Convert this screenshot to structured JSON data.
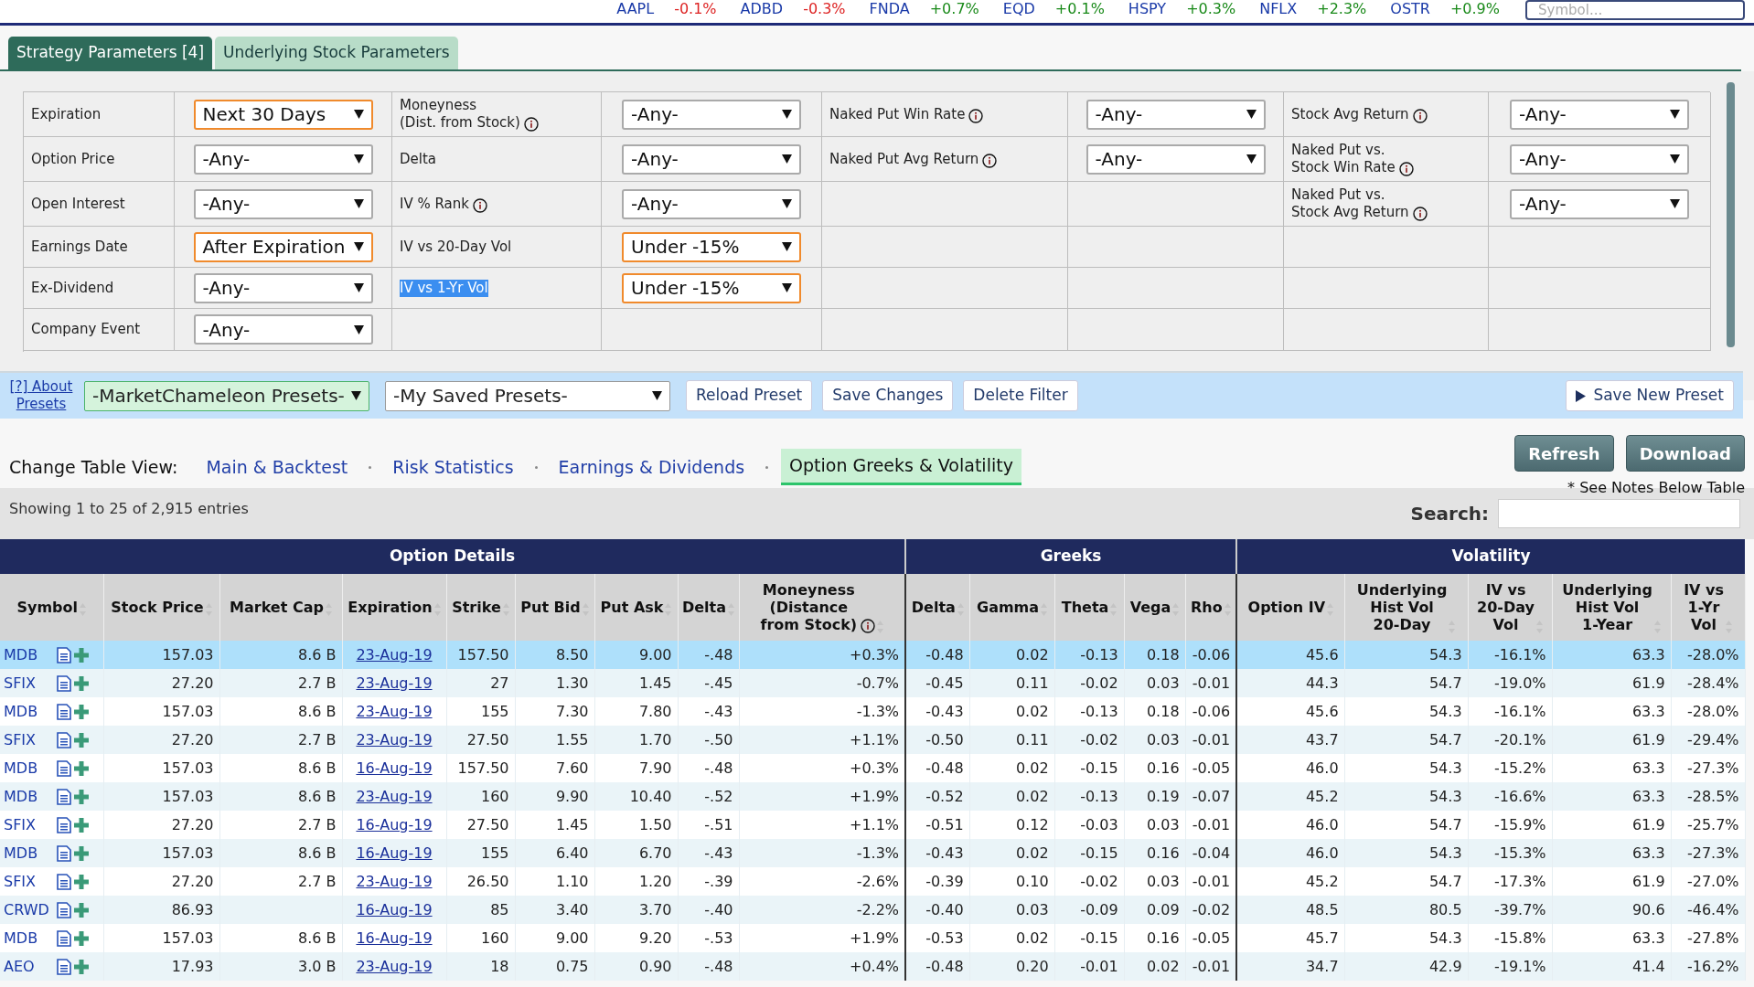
{
  "ticker": [
    {
      "symbol": "AAPL",
      "change": "-0.1%",
      "color": "#dd2222"
    },
    {
      "symbol": "ADBD",
      "change": "-0.3%",
      "color": "#dd2222"
    },
    {
      "symbol": "FNDA",
      "change": "+0.7%",
      "color": "#1a8a1a"
    },
    {
      "symbol": "EQD",
      "change": "+0.1%",
      "color": "#1a8a1a"
    },
    {
      "symbol": "HSPY",
      "change": "+0.3%",
      "color": "#1a8a1a"
    },
    {
      "symbol": "NFLX",
      "change": "+2.3%",
      "color": "#1a8a1a"
    },
    {
      "symbol": "OSTR",
      "change": "+0.9%",
      "color": "#1a8a1a"
    }
  ],
  "symbol_search": {
    "placeholder": "Symbol..."
  },
  "tabs": [
    {
      "label": "Strategy Parameters [4]",
      "selected": true
    },
    {
      "label": "Underlying Stock Parameters",
      "selected": false
    }
  ],
  "filters": {
    "rows": [
      {
        "cells": [
          {
            "label": [
              "Expiration"
            ],
            "info": false,
            "value": "Next 30 Days",
            "active": true
          },
          {
            "label": [
              "Moneyness",
              "(Dist. from Stock)"
            ],
            "info": true,
            "value": "-Any-",
            "active": false
          },
          {
            "label": [
              "Naked Put Win Rate"
            ],
            "info": true,
            "value": "-Any-",
            "active": false
          },
          {
            "label": [
              "Stock Avg Return"
            ],
            "info": true,
            "value": "-Any-",
            "active": false
          }
        ]
      },
      {
        "cells": [
          {
            "label": [
              "Option Price"
            ],
            "info": false,
            "value": "-Any-",
            "active": false
          },
          {
            "label": [
              "Delta"
            ],
            "info": false,
            "value": "-Any-",
            "active": false
          },
          {
            "label": [
              "Naked Put Avg Return"
            ],
            "info": true,
            "value": "-Any-",
            "active": false
          },
          {
            "label": [
              "Naked Put vs.",
              "Stock Win Rate"
            ],
            "info": true,
            "value": "-Any-",
            "active": false
          }
        ]
      },
      {
        "cells": [
          {
            "label": [
              "Open Interest"
            ],
            "info": false,
            "value": "-Any-",
            "active": false
          },
          {
            "label": [
              "IV % Rank"
            ],
            "info": true,
            "value": "-Any-",
            "active": false
          },
          null,
          {
            "label": [
              "Naked Put vs.",
              "Stock Avg Return"
            ],
            "info": true,
            "value": "-Any-",
            "active": false
          }
        ]
      },
      {
        "cells": [
          {
            "label": [
              "Earnings Date"
            ],
            "info": false,
            "value": "After Expiration",
            "active": true
          },
          {
            "label": [
              "IV vs 20-Day Vol"
            ],
            "info": false,
            "value": "Under -15%",
            "active": true
          },
          null,
          null
        ]
      },
      {
        "cells": [
          {
            "label": [
              "Ex-Dividend"
            ],
            "info": false,
            "value": "-Any-",
            "active": false
          },
          {
            "label": [
              "IV vs 1-Yr Vol"
            ],
            "info": false,
            "text_selected": true,
            "value": "Under -15%",
            "active": true
          },
          null,
          null
        ]
      },
      {
        "cells": [
          {
            "label": [
              "Company Event"
            ],
            "info": false,
            "value": "-Any-",
            "active": false
          },
          null,
          null,
          null
        ]
      }
    ]
  },
  "presets": {
    "about_link": "[?] About Presets",
    "marketchameleon_select": "-MarketChameleon Presets-",
    "saved_select": "-My Saved Presets-",
    "buttons": [
      "Reload Preset",
      "Save Changes",
      "Delete Filter"
    ],
    "save_new": "Save New Preset"
  },
  "table_view": {
    "label": "Change Table View:",
    "views": [
      {
        "label": "Main & Backtest",
        "selected": false
      },
      {
        "label": "Risk Statistics",
        "selected": false
      },
      {
        "label": "Earnings & Dividends",
        "selected": false
      },
      {
        "label": "Option Greeks & Volatility",
        "selected": true
      }
    ]
  },
  "actions": [
    "Refresh",
    "Download"
  ],
  "note": "* See Notes Below Table",
  "showing": "Showing 1 to 25 of 2,915 entries",
  "search": {
    "label": "Search:"
  },
  "table": {
    "groups": [
      {
        "label": "Option Details",
        "columns": [
          {
            "label": [
              "Symbol"
            ]
          },
          {
            "label": [
              "Stock Price"
            ]
          },
          {
            "label": [
              "Market Cap"
            ]
          },
          {
            "label": [
              "Expiration"
            ]
          },
          {
            "label": [
              "Strike"
            ]
          },
          {
            "label": [
              "Put Bid"
            ]
          },
          {
            "label": [
              "Put Ask"
            ]
          },
          {
            "label": [
              "Delta"
            ]
          },
          {
            "label": [
              "Moneyness",
              "(Distance",
              "from Stock)"
            ],
            "info": true
          }
        ]
      },
      {
        "label": "Greeks",
        "columns": [
          {
            "label": [
              "Delta"
            ]
          },
          {
            "label": [
              "Gamma"
            ]
          },
          {
            "label": [
              "Theta"
            ]
          },
          {
            "label": [
              "Vega"
            ]
          },
          {
            "label": [
              "Rho"
            ]
          }
        ]
      },
      {
        "label": "Volatility",
        "columns": [
          {
            "label": [
              "Option IV"
            ]
          },
          {
            "label": [
              "Underlying",
              "Hist Vol",
              "20-Day"
            ]
          },
          {
            "label": [
              "IV vs",
              "20-Day",
              "Vol"
            ]
          },
          {
            "label": [
              "Underlying",
              "Hist Vol",
              "1-Year"
            ]
          },
          {
            "label": [
              "IV vs",
              "1-Yr",
              "Vol"
            ]
          }
        ]
      }
    ],
    "rows": [
      {
        "selected": true,
        "cells": [
          "MDB",
          "157.03",
          "8.6 B",
          "23-Aug-19",
          "157.50",
          "8.50",
          "9.00",
          "-.48",
          "+0.3%",
          "-0.48",
          "0.02",
          "-0.13",
          "0.18",
          "-0.06",
          "45.6",
          "54.3",
          "-16.1%",
          "63.3",
          "-28.0%"
        ]
      },
      {
        "selected": false,
        "cells": [
          "SFIX",
          "27.20",
          "2.7 B",
          "23-Aug-19",
          "27",
          "1.30",
          "1.45",
          "-.45",
          "-0.7%",
          "-0.45",
          "0.11",
          "-0.02",
          "0.03",
          "-0.01",
          "44.3",
          "54.7",
          "-19.0%",
          "61.9",
          "-28.4%"
        ]
      },
      {
        "selected": false,
        "cells": [
          "MDB",
          "157.03",
          "8.6 B",
          "23-Aug-19",
          "155",
          "7.30",
          "7.80",
          "-.43",
          "-1.3%",
          "-0.43",
          "0.02",
          "-0.13",
          "0.18",
          "-0.06",
          "45.6",
          "54.3",
          "-16.1%",
          "63.3",
          "-28.0%"
        ]
      },
      {
        "selected": false,
        "cells": [
          "SFIX",
          "27.20",
          "2.7 B",
          "23-Aug-19",
          "27.50",
          "1.55",
          "1.70",
          "-.50",
          "+1.1%",
          "-0.50",
          "0.11",
          "-0.02",
          "0.03",
          "-0.01",
          "43.7",
          "54.7",
          "-20.1%",
          "61.9",
          "-29.4%"
        ]
      },
      {
        "selected": false,
        "cells": [
          "MDB",
          "157.03",
          "8.6 B",
          "16-Aug-19",
          "157.50",
          "7.60",
          "7.90",
          "-.48",
          "+0.3%",
          "-0.48",
          "0.02",
          "-0.15",
          "0.16",
          "-0.05",
          "46.0",
          "54.3",
          "-15.2%",
          "63.3",
          "-27.3%"
        ]
      },
      {
        "selected": false,
        "cells": [
          "MDB",
          "157.03",
          "8.6 B",
          "23-Aug-19",
          "160",
          "9.90",
          "10.40",
          "-.52",
          "+1.9%",
          "-0.52",
          "0.02",
          "-0.13",
          "0.19",
          "-0.07",
          "45.2",
          "54.3",
          "-16.6%",
          "63.3",
          "-28.5%"
        ]
      },
      {
        "selected": false,
        "cells": [
          "SFIX",
          "27.20",
          "2.7 B",
          "16-Aug-19",
          "27.50",
          "1.45",
          "1.50",
          "-.51",
          "+1.1%",
          "-0.51",
          "0.12",
          "-0.03",
          "0.03",
          "-0.01",
          "46.0",
          "54.7",
          "-15.9%",
          "61.9",
          "-25.7%"
        ]
      },
      {
        "selected": false,
        "cells": [
          "MDB",
          "157.03",
          "8.6 B",
          "16-Aug-19",
          "155",
          "6.40",
          "6.70",
          "-.43",
          "-1.3%",
          "-0.43",
          "0.02",
          "-0.15",
          "0.16",
          "-0.04",
          "46.0",
          "54.3",
          "-15.3%",
          "63.3",
          "-27.3%"
        ]
      },
      {
        "selected": false,
        "cells": [
          "SFIX",
          "27.20",
          "2.7 B",
          "23-Aug-19",
          "26.50",
          "1.10",
          "1.20",
          "-.39",
          "-2.6%",
          "-0.39",
          "0.10",
          "-0.02",
          "0.03",
          "-0.01",
          "45.2",
          "54.7",
          "-17.3%",
          "61.9",
          "-27.0%"
        ]
      },
      {
        "selected": false,
        "cells": [
          "CRWD",
          "86.93",
          null,
          "16-Aug-19",
          "85",
          "3.40",
          "3.70",
          "-.40",
          "-2.2%",
          "-0.40",
          "0.03",
          "-0.09",
          "0.09",
          "-0.02",
          "48.5",
          "80.5",
          "-39.7%",
          "90.6",
          "-46.4%"
        ]
      },
      {
        "selected": false,
        "cells": [
          "MDB",
          "157.03",
          "8.6 B",
          "16-Aug-19",
          "160",
          "9.00",
          "9.20",
          "-.53",
          "+1.9%",
          "-0.53",
          "0.02",
          "-0.15",
          "0.16",
          "-0.05",
          "45.7",
          "54.3",
          "-15.8%",
          "63.3",
          "-27.8%"
        ]
      },
      {
        "selected": false,
        "cells": [
          "AEO",
          "17.93",
          "3.0 B",
          "23-Aug-19",
          "18",
          "0.75",
          "0.90",
          "-.48",
          "+0.4%",
          "-0.48",
          "0.20",
          "-0.01",
          "0.02",
          "-0.01",
          "34.7",
          "42.9",
          "-19.1%",
          "41.4",
          "-16.2%"
        ]
      }
    ]
  }
}
